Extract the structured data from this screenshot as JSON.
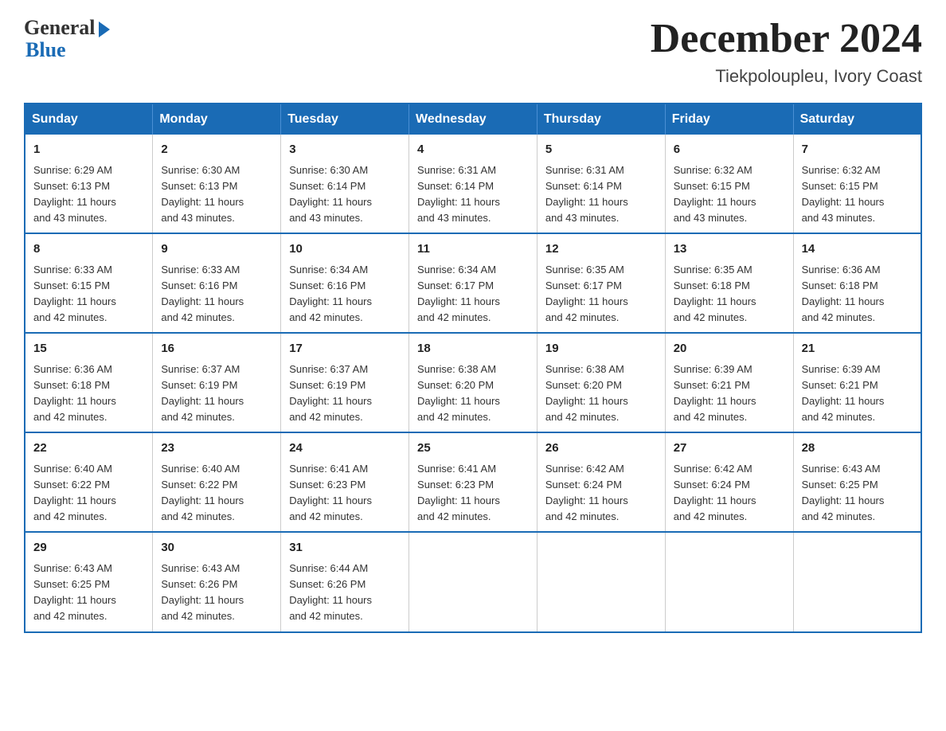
{
  "logo": {
    "general": "General",
    "blue": "Blue"
  },
  "title": "December 2024",
  "location": "Tiekpoloupleu, Ivory Coast",
  "days_of_week": [
    "Sunday",
    "Monday",
    "Tuesday",
    "Wednesday",
    "Thursday",
    "Friday",
    "Saturday"
  ],
  "weeks": [
    [
      {
        "day": "1",
        "sunrise": "6:29 AM",
        "sunset": "6:13 PM",
        "daylight": "11 hours and 43 minutes."
      },
      {
        "day": "2",
        "sunrise": "6:30 AM",
        "sunset": "6:13 PM",
        "daylight": "11 hours and 43 minutes."
      },
      {
        "day": "3",
        "sunrise": "6:30 AM",
        "sunset": "6:14 PM",
        "daylight": "11 hours and 43 minutes."
      },
      {
        "day": "4",
        "sunrise": "6:31 AM",
        "sunset": "6:14 PM",
        "daylight": "11 hours and 43 minutes."
      },
      {
        "day": "5",
        "sunrise": "6:31 AM",
        "sunset": "6:14 PM",
        "daylight": "11 hours and 43 minutes."
      },
      {
        "day": "6",
        "sunrise": "6:32 AM",
        "sunset": "6:15 PM",
        "daylight": "11 hours and 43 minutes."
      },
      {
        "day": "7",
        "sunrise": "6:32 AM",
        "sunset": "6:15 PM",
        "daylight": "11 hours and 43 minutes."
      }
    ],
    [
      {
        "day": "8",
        "sunrise": "6:33 AM",
        "sunset": "6:15 PM",
        "daylight": "11 hours and 42 minutes."
      },
      {
        "day": "9",
        "sunrise": "6:33 AM",
        "sunset": "6:16 PM",
        "daylight": "11 hours and 42 minutes."
      },
      {
        "day": "10",
        "sunrise": "6:34 AM",
        "sunset": "6:16 PM",
        "daylight": "11 hours and 42 minutes."
      },
      {
        "day": "11",
        "sunrise": "6:34 AM",
        "sunset": "6:17 PM",
        "daylight": "11 hours and 42 minutes."
      },
      {
        "day": "12",
        "sunrise": "6:35 AM",
        "sunset": "6:17 PM",
        "daylight": "11 hours and 42 minutes."
      },
      {
        "day": "13",
        "sunrise": "6:35 AM",
        "sunset": "6:18 PM",
        "daylight": "11 hours and 42 minutes."
      },
      {
        "day": "14",
        "sunrise": "6:36 AM",
        "sunset": "6:18 PM",
        "daylight": "11 hours and 42 minutes."
      }
    ],
    [
      {
        "day": "15",
        "sunrise": "6:36 AM",
        "sunset": "6:18 PM",
        "daylight": "11 hours and 42 minutes."
      },
      {
        "day": "16",
        "sunrise": "6:37 AM",
        "sunset": "6:19 PM",
        "daylight": "11 hours and 42 minutes."
      },
      {
        "day": "17",
        "sunrise": "6:37 AM",
        "sunset": "6:19 PM",
        "daylight": "11 hours and 42 minutes."
      },
      {
        "day": "18",
        "sunrise": "6:38 AM",
        "sunset": "6:20 PM",
        "daylight": "11 hours and 42 minutes."
      },
      {
        "day": "19",
        "sunrise": "6:38 AM",
        "sunset": "6:20 PM",
        "daylight": "11 hours and 42 minutes."
      },
      {
        "day": "20",
        "sunrise": "6:39 AM",
        "sunset": "6:21 PM",
        "daylight": "11 hours and 42 minutes."
      },
      {
        "day": "21",
        "sunrise": "6:39 AM",
        "sunset": "6:21 PM",
        "daylight": "11 hours and 42 minutes."
      }
    ],
    [
      {
        "day": "22",
        "sunrise": "6:40 AM",
        "sunset": "6:22 PM",
        "daylight": "11 hours and 42 minutes."
      },
      {
        "day": "23",
        "sunrise": "6:40 AM",
        "sunset": "6:22 PM",
        "daylight": "11 hours and 42 minutes."
      },
      {
        "day": "24",
        "sunrise": "6:41 AM",
        "sunset": "6:23 PM",
        "daylight": "11 hours and 42 minutes."
      },
      {
        "day": "25",
        "sunrise": "6:41 AM",
        "sunset": "6:23 PM",
        "daylight": "11 hours and 42 minutes."
      },
      {
        "day": "26",
        "sunrise": "6:42 AM",
        "sunset": "6:24 PM",
        "daylight": "11 hours and 42 minutes."
      },
      {
        "day": "27",
        "sunrise": "6:42 AM",
        "sunset": "6:24 PM",
        "daylight": "11 hours and 42 minutes."
      },
      {
        "day": "28",
        "sunrise": "6:43 AM",
        "sunset": "6:25 PM",
        "daylight": "11 hours and 42 minutes."
      }
    ],
    [
      {
        "day": "29",
        "sunrise": "6:43 AM",
        "sunset": "6:25 PM",
        "daylight": "11 hours and 42 minutes."
      },
      {
        "day": "30",
        "sunrise": "6:43 AM",
        "sunset": "6:26 PM",
        "daylight": "11 hours and 42 minutes."
      },
      {
        "day": "31",
        "sunrise": "6:44 AM",
        "sunset": "6:26 PM",
        "daylight": "11 hours and 42 minutes."
      },
      null,
      null,
      null,
      null
    ]
  ],
  "labels": {
    "sunrise": "Sunrise:",
    "sunset": "Sunset:",
    "daylight": "Daylight:"
  }
}
